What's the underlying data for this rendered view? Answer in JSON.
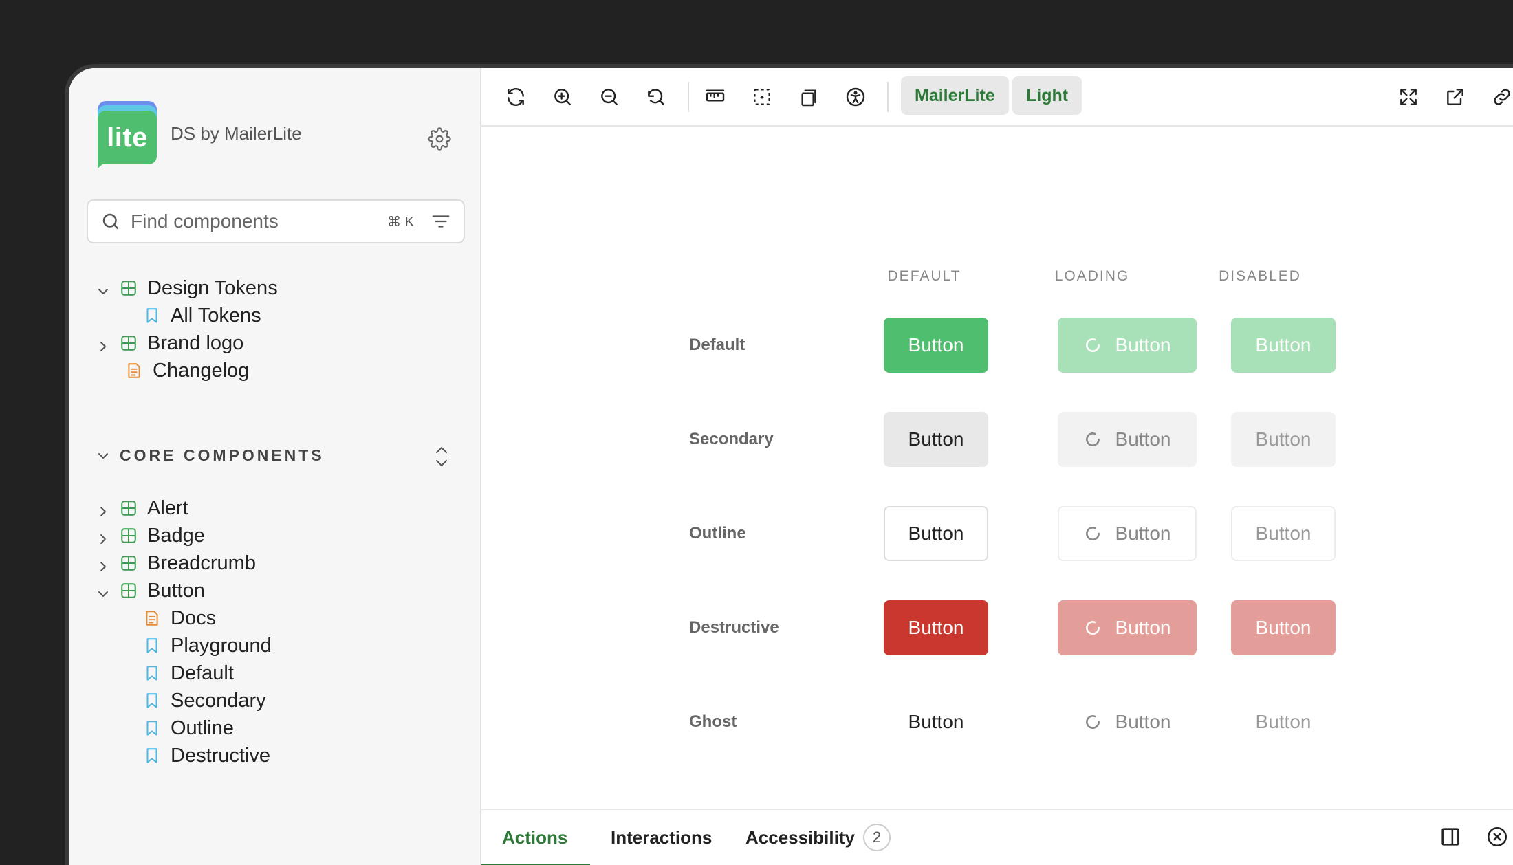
{
  "brand": {
    "logo_text": "lite",
    "name": "DS by MailerLite"
  },
  "search": {
    "placeholder": "Find components",
    "shortcut": "⌘ K"
  },
  "tree_top": [
    {
      "label": "Design Tokens",
      "icon": "component-icon",
      "chevron": "down"
    },
    {
      "label": "All Tokens",
      "icon": "story-icon",
      "chevron": ""
    },
    {
      "label": "Brand logo",
      "icon": "component-icon",
      "chevron": "right"
    },
    {
      "label": "Changelog",
      "icon": "doc-icon",
      "chevron": ""
    }
  ],
  "section": {
    "title": "CORE COMPONENTS"
  },
  "tree_core": [
    {
      "label": "Alert",
      "icon": "component-icon",
      "chevron": "right"
    },
    {
      "label": "Badge",
      "icon": "component-icon",
      "chevron": "right"
    },
    {
      "label": "Breadcrumb",
      "icon": "component-icon",
      "chevron": "right"
    },
    {
      "label": "Button",
      "icon": "component-icon",
      "chevron": "down"
    },
    {
      "label": "Docs",
      "icon": "doc-icon",
      "chevron": ""
    },
    {
      "label": "Playground",
      "icon": "story-icon",
      "chevron": ""
    },
    {
      "label": "Default",
      "icon": "story-icon",
      "chevron": ""
    },
    {
      "label": "Secondary",
      "icon": "story-icon",
      "chevron": ""
    },
    {
      "label": "Outline",
      "icon": "story-icon",
      "chevron": ""
    },
    {
      "label": "Destructive",
      "icon": "story-icon",
      "chevron": ""
    }
  ],
  "toolbar": {
    "theme_pill": "MailerLite",
    "mode_pill": "Light"
  },
  "grid": {
    "columns": [
      "DEFAULT",
      "LOADING",
      "DISABLED"
    ],
    "rows": [
      "Default",
      "Secondary",
      "Outline",
      "Destructive",
      "Ghost"
    ],
    "button_label": "Button"
  },
  "bottom_tabs": {
    "actions": "Actions",
    "interactions": "Interactions",
    "accessibility": "Accessibility",
    "accessibility_count": "2"
  },
  "colors": {
    "accent": "#2d7a38",
    "primary": "#4fbe6e",
    "destructive": "#c9372e"
  }
}
